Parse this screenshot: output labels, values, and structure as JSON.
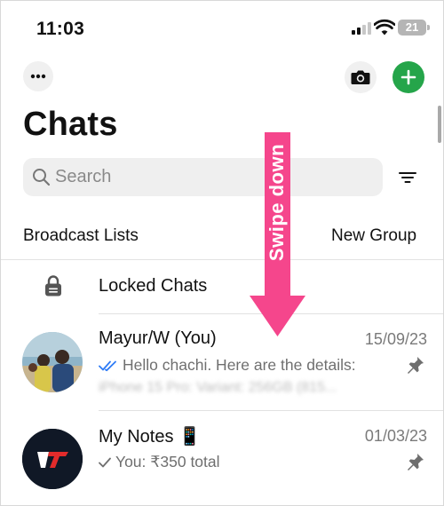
{
  "status_bar": {
    "time": "11:03",
    "battery": "21"
  },
  "header": {
    "title": "Chats"
  },
  "search": {
    "placeholder": "Search"
  },
  "links": {
    "broadcast": "Broadcast Lists",
    "new_group": "New Group"
  },
  "locked_chats": {
    "label": "Locked Chats"
  },
  "chats": [
    {
      "name": "Mayur/W (You)",
      "date": "15/09/23",
      "preview": "Hello chachi. Here are the details:",
      "preview_blurred": "iPhone 15 Pro: Variant: 256GB (815...",
      "read_status": "read",
      "pinned": true
    },
    {
      "name": "My Notes 📱",
      "date": "01/03/23",
      "preview": "You: ₹350 total",
      "read_status": "sent",
      "pinned": true
    }
  ],
  "overlay": {
    "text": "Swipe down"
  },
  "icons": [
    "more-icon",
    "camera-icon",
    "plus-icon",
    "search-icon",
    "filter-icon",
    "lock-icon",
    "pin-icon",
    "double-check-icon",
    "check-icon"
  ],
  "colors": {
    "accent_green": "#25a54a",
    "overlay_pink": "#f5468c",
    "read_tick_blue": "#2f7cf6"
  }
}
